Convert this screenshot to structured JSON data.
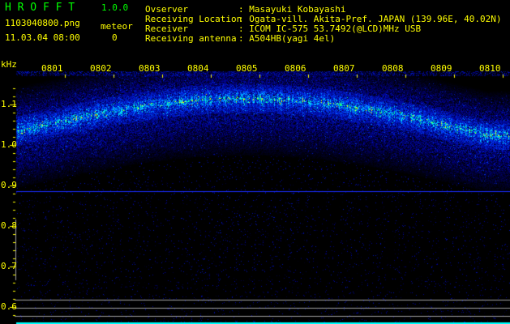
{
  "header": {
    "app_title": "H R O F F T",
    "version": "1.0.0",
    "filename": "1103040800.png",
    "datetime": "11.03.04 08:00",
    "meteor_label": "meteor",
    "meteor_count": "0"
  },
  "info": [
    {
      "label": "Ovserver",
      "value": ": Masayuki Kobayashi"
    },
    {
      "label": "Receiving Location",
      "value": ": Ogata-vill. Akita-Pref. JAPAN (139.96E, 40.02N)"
    },
    {
      "label": "Receiver",
      "value": ": ICOM IC-575 53.7492(@LCD)MHz USB"
    },
    {
      "label": "Receiving antenna",
      "value": ": A504HB(yagi 4el)"
    }
  ],
  "spectrogram": {
    "y_unit": "kHz",
    "y_ticks": [
      "1.1",
      "1.0",
      "0.9",
      "0.8",
      "0.7",
      "0.6"
    ],
    "x_ticks": [
      "0801",
      "0802",
      "0803",
      "0804",
      "0805",
      "0806",
      "0807",
      "0808",
      "0809",
      "0810"
    ],
    "colors": {
      "text": "#ffff00",
      "title": "#00ff00",
      "noise": "#0000ff",
      "signal": "#00ff80",
      "marker": "#00ffff",
      "guide": "#a0a0a0"
    }
  }
}
